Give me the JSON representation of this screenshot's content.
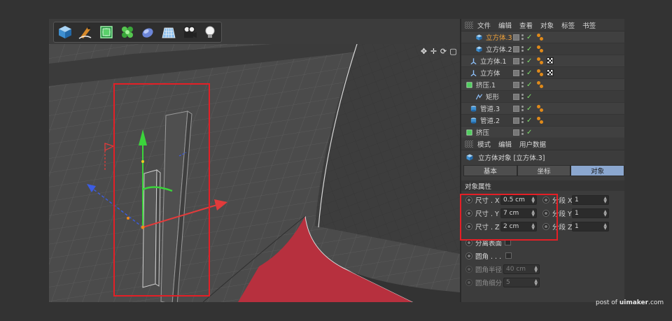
{
  "toolbar": {
    "tools": [
      {
        "name": "cube-tool-icon"
      },
      {
        "name": "pen-spline-tool-icon"
      },
      {
        "name": "subdivision-nurbs-icon"
      },
      {
        "name": "cloner-mograph-icon"
      },
      {
        "name": "deformer-bend-icon"
      },
      {
        "name": "floor-scene-icon"
      },
      {
        "name": "camera-icon"
      },
      {
        "name": "light-bulb-icon"
      }
    ]
  },
  "viewport": {
    "nav_icons": [
      "✥",
      "✛",
      "⟳",
      "▢"
    ]
  },
  "object_manager": {
    "menu": [
      "文件",
      "编辑",
      "查看",
      "对象",
      "标签",
      "书签"
    ],
    "objects": [
      {
        "name": "立方体.3",
        "icon": "cube-icon",
        "active": true,
        "tags": [
          "phong"
        ]
      },
      {
        "name": "立方体.2",
        "icon": "cube-icon",
        "active": false,
        "tags": [
          "phong"
        ]
      },
      {
        "name": "立方体.1",
        "icon": "null-axis-icon",
        "active": false,
        "tags": [
          "phong",
          "checker"
        ]
      },
      {
        "name": "立方体",
        "icon": "null-axis-icon",
        "active": false,
        "tags": [
          "phong",
          "checker"
        ]
      },
      {
        "name": "挤压.1",
        "icon": "extrude-icon",
        "active": false,
        "tags": [
          "phong"
        ]
      },
      {
        "name": "矩形",
        "icon": "rectangle-spline-icon",
        "active": false,
        "tags": []
      },
      {
        "name": "管道.3",
        "icon": "tube-icon",
        "active": false,
        "tags": [
          "phong"
        ]
      },
      {
        "name": "管道.2",
        "icon": "tube-icon",
        "active": false,
        "tags": [
          "phong"
        ]
      },
      {
        "name": "挤压",
        "icon": "extrude-icon",
        "active": false,
        "tags": []
      }
    ]
  },
  "attribute_manager": {
    "menu": [
      "模式",
      "编辑",
      "用户数据"
    ],
    "title": "立方体对象 [立方体.3]",
    "tabs": [
      {
        "label": "基本",
        "active": false
      },
      {
        "label": "坐标",
        "active": false
      },
      {
        "label": "对象",
        "active": true
      }
    ],
    "section": "对象属性",
    "size": [
      {
        "label": "尺寸 . X",
        "value": "0.5 cm"
      },
      {
        "label": "尺寸 . Y",
        "value": "7 cm"
      },
      {
        "label": "尺寸 . Z",
        "value": "2 cm"
      }
    ],
    "segments": [
      {
        "label": "分段 X",
        "value": "1"
      },
      {
        "label": "分段 Y",
        "value": "1"
      },
      {
        "label": "分段 Z",
        "value": "1"
      }
    ],
    "separate_surfaces": "分离表面",
    "fillet": "圆角 . . .",
    "fillet_radius": {
      "label": "圆角半径",
      "value": "40 cm"
    },
    "fillet_subdivision": {
      "label": "圆角细分",
      "value": "5"
    }
  },
  "watermark": {
    "prefix": "post of ",
    "brand": "uimaker",
    "suffix": ".com"
  },
  "colors": {
    "highlight": "#e41f26",
    "active_tab": "#8ba7cf",
    "active_object": "#f0a23a"
  }
}
